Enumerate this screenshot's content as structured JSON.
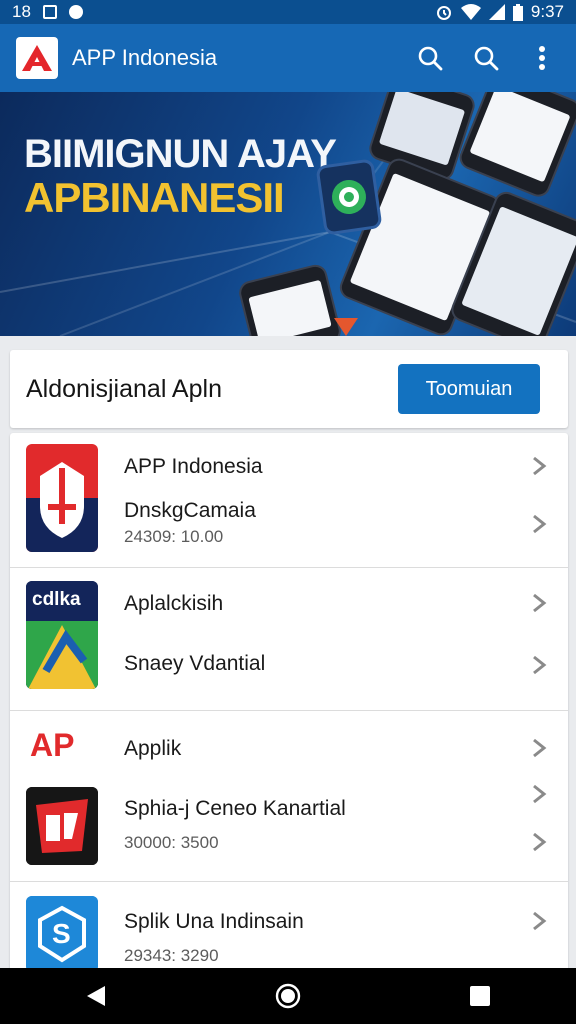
{
  "status_bar": {
    "time_left": "18",
    "time_right": "9:37"
  },
  "app_bar": {
    "title": "APP Indonesia",
    "logo_letter": "A",
    "action_icons": [
      "search-icon",
      "search-icon",
      "more-vert-icon"
    ]
  },
  "banner": {
    "line1": "BIIMIGNUN AJAY",
    "line2": "APBINANESII"
  },
  "section": {
    "title": "Aldonisjianal Apln",
    "button_label": "Toomuian"
  },
  "list": [
    {
      "icon_text": "",
      "title": "APP Indonesia",
      "subtitle": "DnskgCamaia",
      "meta": "24309: 10.00"
    },
    {
      "icon_text": "cdlka",
      "title": "Aplalckisih",
      "subtitle": "Snaey Vdantial"
    },
    {
      "icon_text": "AP",
      "title": "Applik",
      "subtitle": "Sphia-j Ceneo Kanartial",
      "meta": "30000: 3500"
    },
    {
      "icon_text": "S",
      "title": "Splik Una Indinsain",
      "meta": "29343: 3290"
    }
  ],
  "colors": {
    "app_bar": "#1668b5",
    "status_bar": "#0b4f90",
    "accent": "#1372c0",
    "banner_accent": "#f2c230"
  }
}
